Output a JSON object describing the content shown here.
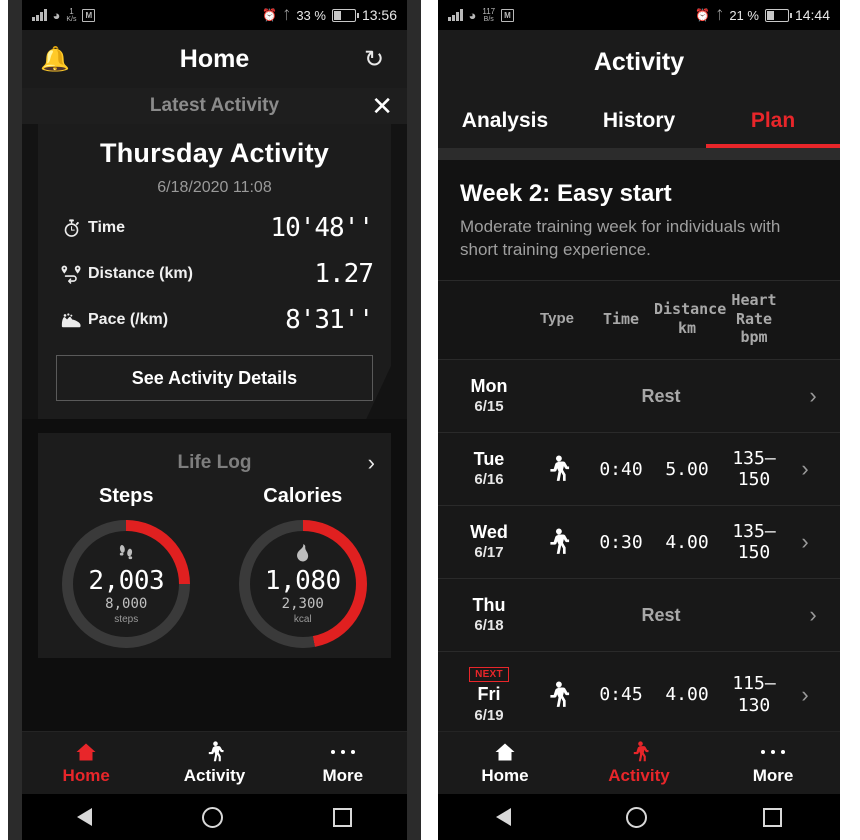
{
  "left_phone": {
    "statusbar": {
      "net_speed_value": "1",
      "net_speed_unit": "K/s",
      "m_badge": "M",
      "battery_percent": "33 %",
      "clock": "13:56",
      "icons": [
        "signal-icon",
        "wifi-icon",
        "alarm-icon",
        "bluetooth-icon",
        "battery-icon"
      ]
    },
    "appbar": {
      "title": "Home",
      "left_icon": "bell-icon",
      "right_icon": "sync-icon"
    },
    "latest_activity": {
      "section_label": "Latest Activity",
      "close_icon": "close-icon",
      "title": "Thursday Activity",
      "date": "6/18/2020 11:08",
      "metrics": [
        {
          "icon": "stopwatch-icon",
          "label": "Time",
          "value": "10'48''"
        },
        {
          "icon": "route-pin-icon",
          "label": "Distance (km)",
          "value": "1.27"
        },
        {
          "icon": "shoe-icon",
          "label": "Pace (/km)",
          "value": "8'31''"
        }
      ],
      "details_button": "See Activity Details"
    },
    "life_log": {
      "section_label": "Life Log",
      "chevron_icon": "chevron-right-icon",
      "rings": [
        {
          "caption": "Steps",
          "icon": "footsteps-icon",
          "value": "2,003",
          "goal": "8,000",
          "unit": "steps",
          "percent": 25,
          "color": "#e02020"
        },
        {
          "caption": "Calories",
          "icon": "flame-icon",
          "value": "1,080",
          "goal": "2,300",
          "unit": "kcal",
          "percent": 47,
          "color": "#e02020"
        }
      ]
    },
    "bottom_nav": [
      {
        "label": "Home",
        "icon": "home-icon",
        "active": true
      },
      {
        "label": "Activity",
        "icon": "runner-icon",
        "active": false
      },
      {
        "label": "More",
        "icon": "ellipsis-icon",
        "active": false
      }
    ]
  },
  "right_phone": {
    "statusbar": {
      "net_speed_value": "117",
      "net_speed_unit": "B/s",
      "m_badge": "M",
      "battery_percent": "21 %",
      "clock": "14:44"
    },
    "appbar": {
      "title": "Activity"
    },
    "tabs": [
      {
        "label": "Analysis",
        "active": false
      },
      {
        "label": "History",
        "active": false
      },
      {
        "label": "Plan",
        "active": true
      }
    ],
    "week": {
      "title": "Week 2: Easy start",
      "description": "Moderate training week for individuals with short training experience."
    },
    "table": {
      "headers": [
        "",
        "Type",
        "Time",
        "Distance\nkm",
        "Heart Rate\nbpm",
        ""
      ],
      "header_type": "Type",
      "header_time": "Time",
      "header_distance_1": "Distance",
      "header_distance_2": "km",
      "header_hr_1": "Heart",
      "header_hr_2": "Rate",
      "header_hr_3": "bpm",
      "rows": [
        {
          "day": "Mon",
          "date": "6/15",
          "rest": "Rest",
          "type": null,
          "time": null,
          "distance": null,
          "hr1": null,
          "hr2": null,
          "badge": null
        },
        {
          "day": "Tue",
          "date": "6/16",
          "rest": null,
          "type": "runner-icon",
          "time": "0:40",
          "distance": "5.00",
          "hr1": "135–",
          "hr2": "150",
          "badge": null
        },
        {
          "day": "Wed",
          "date": "6/17",
          "rest": null,
          "type": "runner-icon",
          "time": "0:30",
          "distance": "4.00",
          "hr1": "135–",
          "hr2": "150",
          "badge": null
        },
        {
          "day": "Thu",
          "date": "6/18",
          "rest": "Rest",
          "type": null,
          "time": null,
          "distance": null,
          "hr1": null,
          "hr2": null,
          "badge": null
        },
        {
          "day": "Fri",
          "date": "6/19",
          "rest": null,
          "type": "runner-icon",
          "time": "0:45",
          "distance": "4.00",
          "hr1": "115–",
          "hr2": "130",
          "badge": "NEXT"
        }
      ],
      "chevron_icon": "chevron-right-icon"
    },
    "bottom_nav": [
      {
        "label": "Home",
        "icon": "home-icon",
        "active": false
      },
      {
        "label": "Activity",
        "icon": "runner-icon",
        "active": true
      },
      {
        "label": "More",
        "icon": "ellipsis-icon",
        "active": false
      }
    ]
  },
  "theme": {
    "accent": "#e8262a",
    "background": "#0e0e0e",
    "card": "#1c1c1c",
    "text": "#ffffff",
    "muted": "#9a9a9a"
  }
}
